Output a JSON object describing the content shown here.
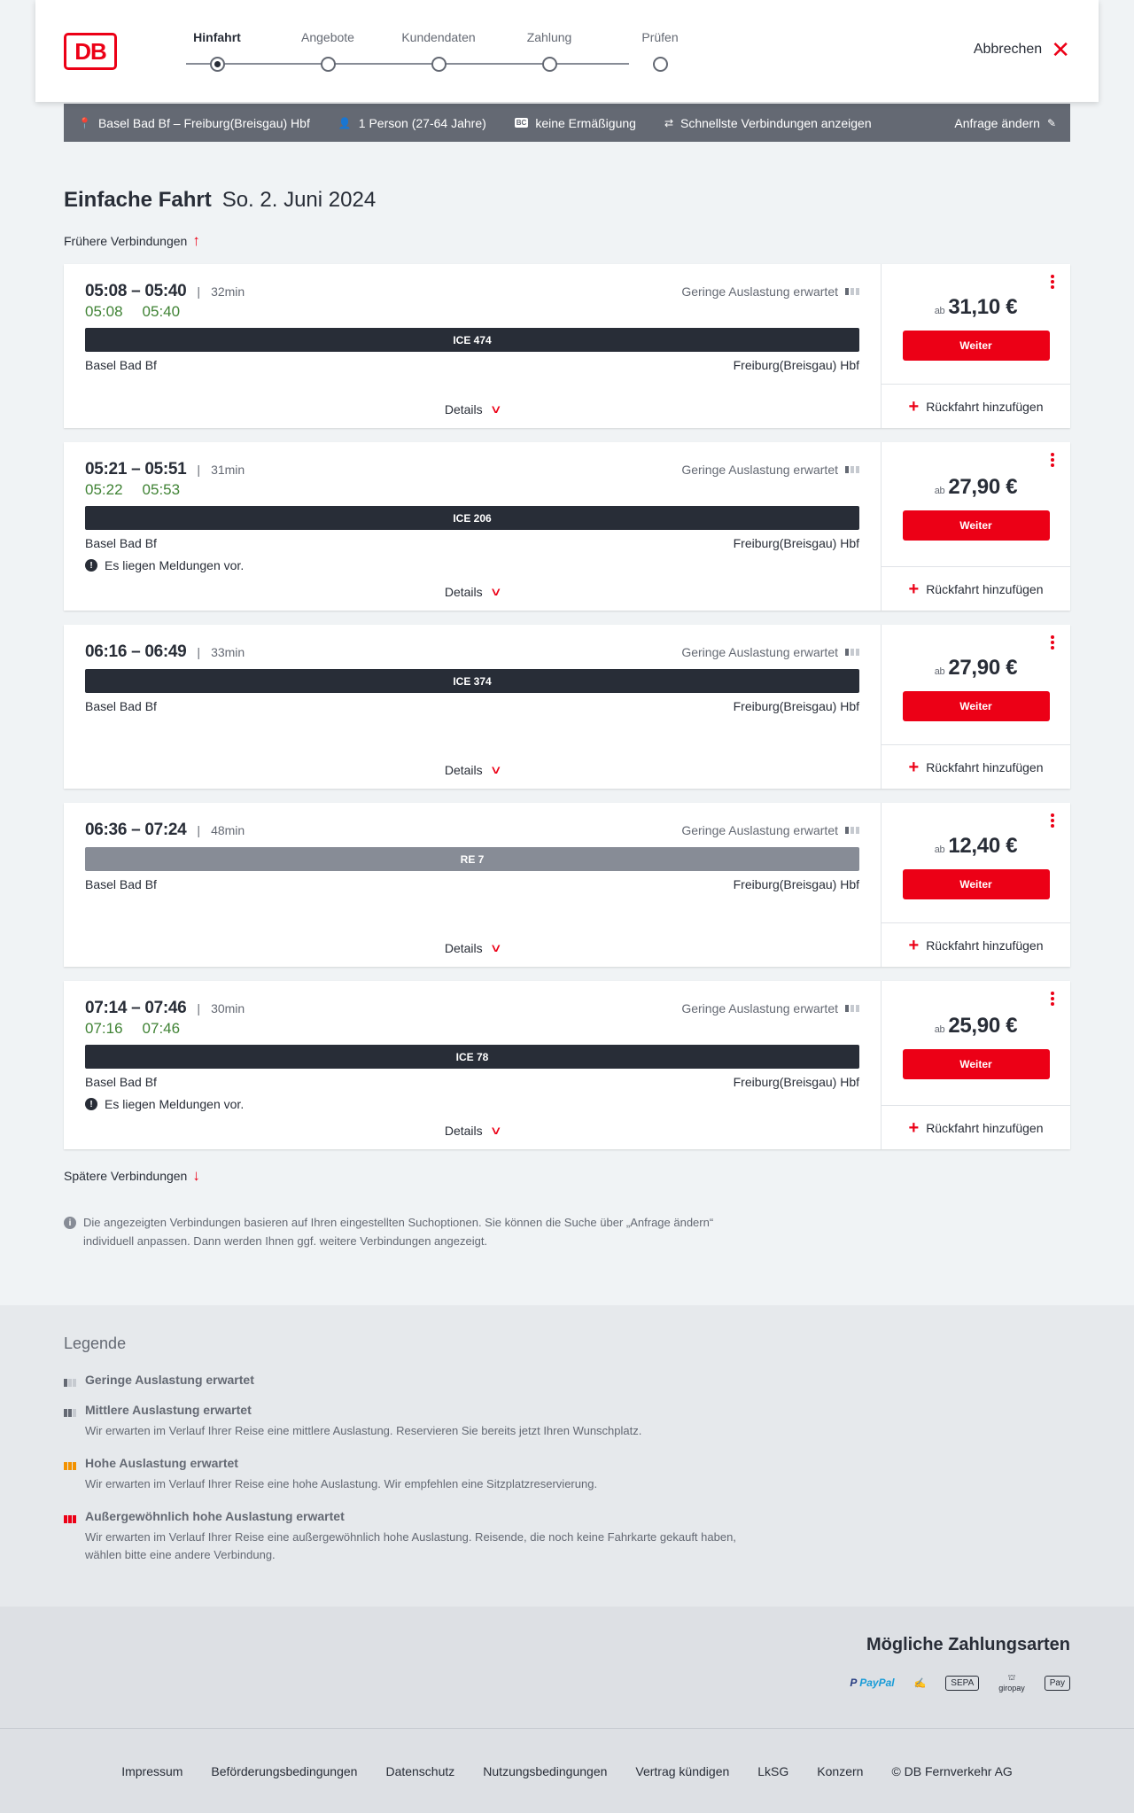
{
  "header": {
    "logo": "DB",
    "steps": [
      "Hinfahrt",
      "Angebote",
      "Kundendaten",
      "Zahlung",
      "Prüfen"
    ],
    "cancel_label": "Abbrechen"
  },
  "searchbar": {
    "route": "Basel Bad Bf – Freiburg(Breisgau) Hbf",
    "passengers": "1 Person (27-64 Jahre)",
    "bc_badge": "BC",
    "discount": "keine Ermäßigung",
    "fastest": "Schnellste Verbindungen anzeigen",
    "change": "Anfrage ändern"
  },
  "main": {
    "title": "Einfache Fahrt",
    "date": "So. 2. Juni 2024",
    "earlier": "Frühere Verbindungen",
    "later": "Spätere Verbindungen",
    "note": "Die angezeigten Verbindungen basieren auf Ihren eingestellten Suchoptionen. Sie können die Suche über „Anfrage ändern“ individuell anpassen. Dann werden Ihnen ggf. weitere Verbindungen angezeigt."
  },
  "connections": [
    {
      "times": "05:08 – 05:40",
      "duration": "32min",
      "occupancy": "Geringe Auslastung erwartet",
      "rt_dep": "05:08",
      "rt_arr": "05:40",
      "train": "ICE 474",
      "from": "Basel Bad Bf",
      "to": "Freiburg(Breisgau) Hbf",
      "message": "",
      "details": "Details",
      "price_prefix": "ab",
      "price": "31,10 €",
      "weiter": "Weiter",
      "return": "Rückfahrt hinzufügen"
    },
    {
      "times": "05:21 – 05:51",
      "duration": "31min",
      "occupancy": "Geringe Auslastung erwartet",
      "rt_dep": "05:22",
      "rt_arr": "05:53",
      "train": "ICE 206",
      "from": "Basel Bad Bf",
      "to": "Freiburg(Breisgau) Hbf",
      "message": "Es liegen Meldungen vor.",
      "details": "Details",
      "price_prefix": "ab",
      "price": "27,90 €",
      "weiter": "Weiter",
      "return": "Rückfahrt hinzufügen"
    },
    {
      "times": "06:16 – 06:49",
      "duration": "33min",
      "occupancy": "Geringe Auslastung erwartet",
      "rt_dep": "",
      "rt_arr": "",
      "train": "ICE 374",
      "from": "Basel Bad Bf",
      "to": "Freiburg(Breisgau) Hbf",
      "message": "",
      "details": "Details",
      "price_prefix": "ab",
      "price": "27,90 €",
      "weiter": "Weiter",
      "return": "Rückfahrt hinzufügen"
    },
    {
      "times": "06:36 – 07:24",
      "duration": "48min",
      "occupancy": "Geringe Auslastung erwartet",
      "rt_dep": "",
      "rt_arr": "",
      "train": "RE 7",
      "from": "Basel Bad Bf",
      "to": "Freiburg(Breisgau) Hbf",
      "message": "",
      "details": "Details",
      "price_prefix": "ab",
      "price": "12,40 €",
      "weiter": "Weiter",
      "return": "Rückfahrt hinzufügen"
    },
    {
      "times": "07:14 – 07:46",
      "duration": "30min",
      "occupancy": "Geringe Auslastung erwartet",
      "rt_dep": "07:16",
      "rt_arr": "07:46",
      "train": "ICE 78",
      "from": "Basel Bad Bf",
      "to": "Freiburg(Breisgau) Hbf",
      "message": "Es liegen Meldungen vor.",
      "details": "Details",
      "price_prefix": "ab",
      "price": "25,90 €",
      "weiter": "Weiter",
      "return": "Rückfahrt hinzufügen"
    }
  ],
  "legend": {
    "title": "Legende",
    "items": [
      {
        "title": "Geringe Auslastung erwartet",
        "desc": ""
      },
      {
        "title": "Mittlere Auslastung erwartet",
        "desc": "Wir erwarten im Verlauf Ihrer Reise eine mittlere Auslastung. Reservieren Sie bereits jetzt Ihren Wunschplatz."
      },
      {
        "title": "Hohe Auslastung erwartet",
        "desc": "Wir erwarten im Verlauf Ihrer Reise eine hohe Auslastung. Wir empfehlen eine Sitzplatzreservierung."
      },
      {
        "title": "Außergewöhnlich hohe Auslastung erwartet",
        "desc": "Wir erwarten im Verlauf Ihrer Reise eine außergewöhnlich hohe Auslastung. Reisende, die noch keine Fahrkarte gekauft haben, wählen bitte eine andere Verbindung."
      }
    ]
  },
  "payment": {
    "title": "Mögliche Zahlungsarten",
    "paypal_a": "Pay",
    "paypal_b": "Pal",
    "sepa": "SEPA",
    "giropay": "giropay",
    "applepay": "Pay"
  },
  "footer": {
    "links": [
      "Impressum",
      "Beförderungsbedingungen",
      "Datenschutz",
      "Nutzungsbedingungen",
      "Vertrag kündigen",
      "LkSG",
      "Konzern",
      "© DB Fernverkehr AG"
    ]
  }
}
